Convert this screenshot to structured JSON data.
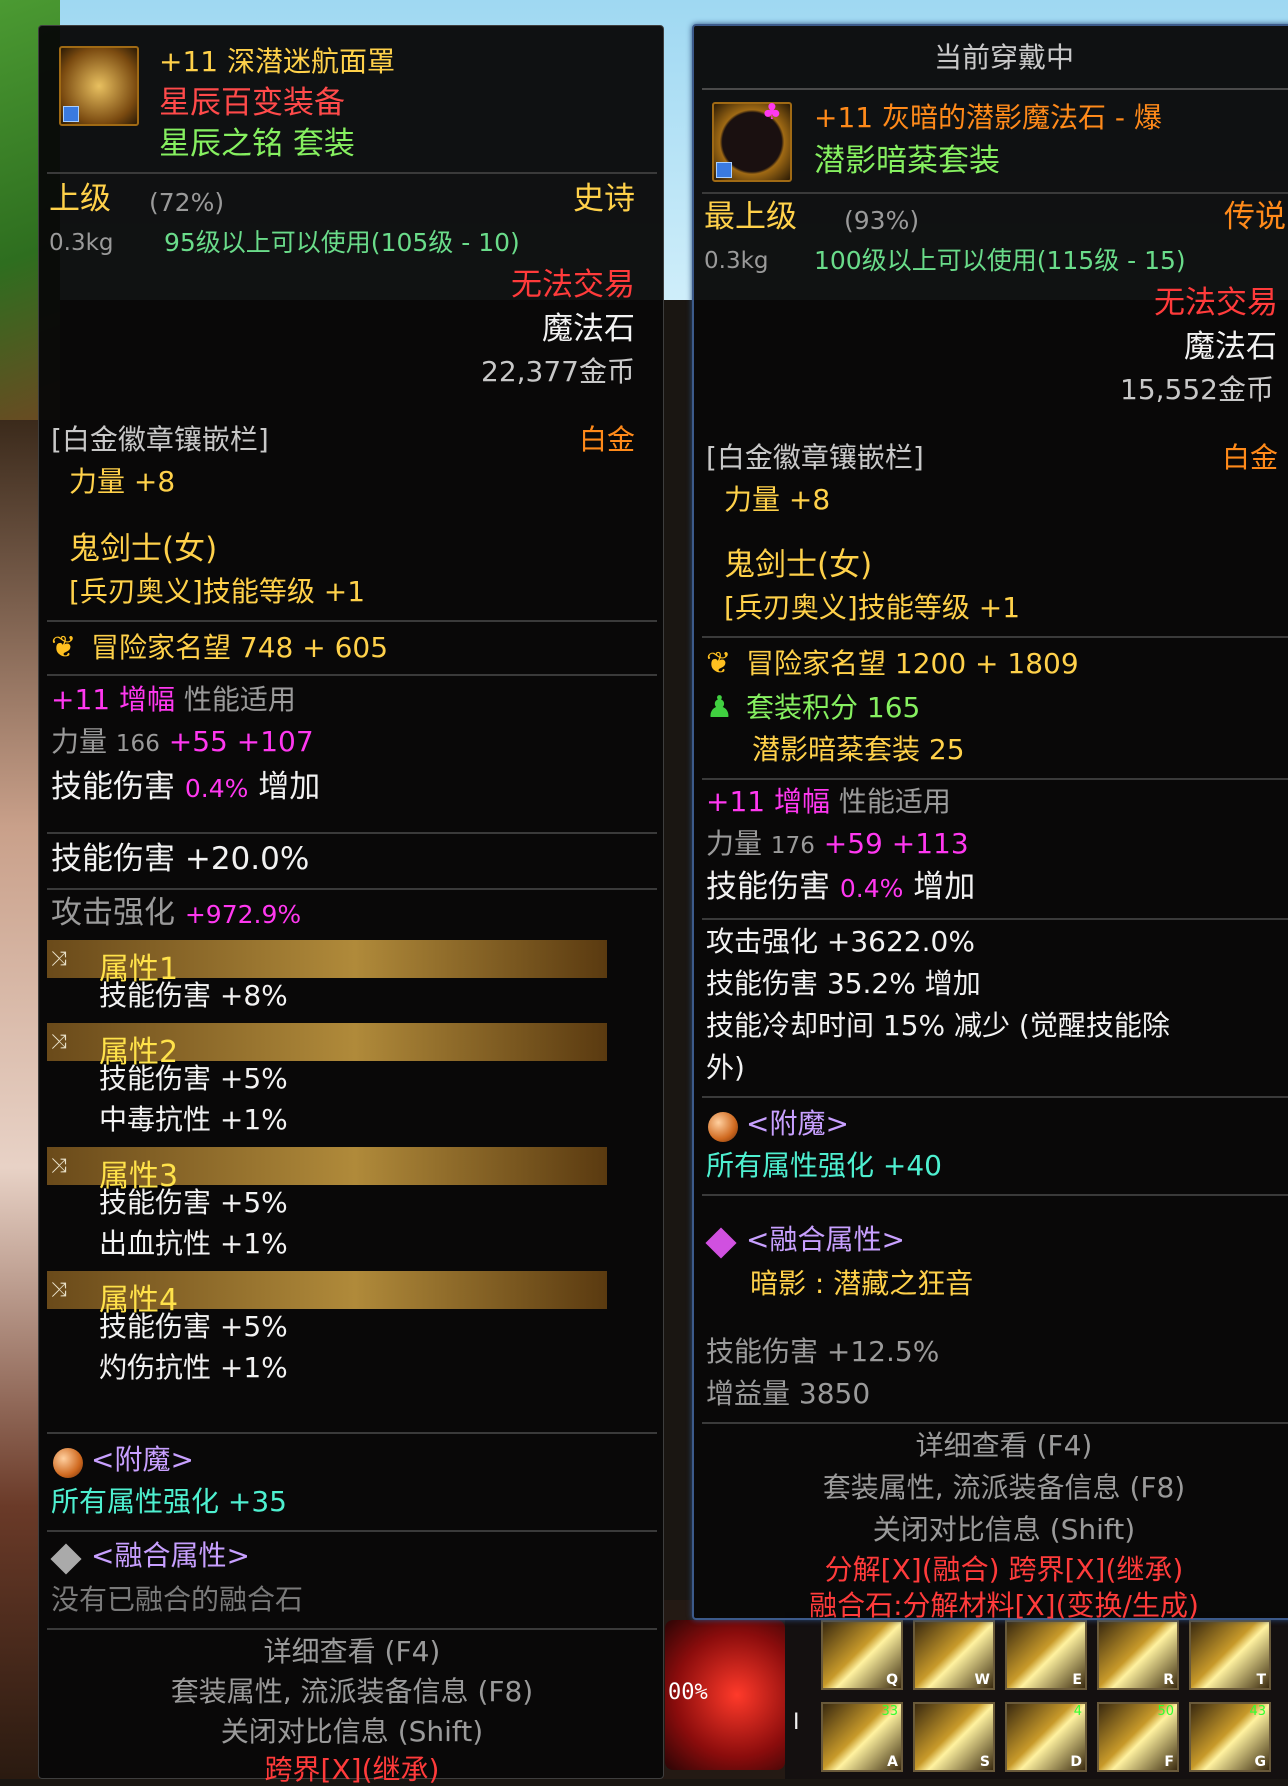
{
  "game": {
    "orb_percent": "00%",
    "skills": [
      {
        "key": "Q",
        "level": ""
      },
      {
        "key": "W",
        "level": ""
      },
      {
        "key": "E",
        "level": ""
      },
      {
        "key": "R",
        "level": ""
      },
      {
        "key": "T",
        "level": ""
      },
      {
        "key": "A",
        "level": "33"
      },
      {
        "key": "S",
        "level": ""
      },
      {
        "key": "D",
        "level": "4"
      },
      {
        "key": "F",
        "level": "50"
      },
      {
        "key": "G",
        "level": "43"
      }
    ],
    "side_key": "I"
  },
  "left": {
    "enhance": "+11",
    "name": "深潜迷航面罩",
    "category": "星辰百变装备",
    "set": "星辰之铭 套装",
    "grade": "上级",
    "grade_pct": "(72%)",
    "rarity": "史诗",
    "weight": "0.3kg",
    "level_req": "95级以上可以使用(105级 - 10)",
    "trade": "无法交易",
    "type": "魔法石",
    "price": "22,377金币",
    "socket": "[白金徽章镶嵌栏]",
    "socket_type": "白金",
    "str_bonus": "力量 +8",
    "class": "鬼剑士(女)",
    "skill_lv": "[兵刃奥义]技能等级 +1",
    "fame": "冒险家名望 748 + 605",
    "amp_head_enh": "+11",
    "amp_head_word": "增幅",
    "amp_head_tail": "性能适用",
    "str_label": "力量",
    "str_base": "166",
    "str_add1": "+55",
    "str_add2": "+107",
    "skdmg_label": "技能伤害",
    "skdmg_val": "0.4%",
    "skdmg_tail": "增加",
    "skdmg2": "技能伤害 +20.0%",
    "atk_label": "攻击强化",
    "atk_val": "+972.9%",
    "attrs": [
      {
        "label": "属性1",
        "lines": [
          "技能伤害 +8%"
        ]
      },
      {
        "label": "属性2",
        "lines": [
          "技能伤害 +5%",
          "中毒抗性 +1%"
        ]
      },
      {
        "label": "属性3",
        "lines": [
          "技能伤害 +5%",
          "出血抗性 +1%"
        ]
      },
      {
        "label": "属性4",
        "lines": [
          "技能伤害 +5%",
          "灼伤抗性 +1%"
        ]
      }
    ],
    "enchant_title": "<附魔>",
    "enchant_val": "所有属性强化 +35",
    "fusion_title": "<融合属性>",
    "fusion_val": "没有已融合的融合石",
    "footer1": "详细查看 (F4)",
    "footer2": "套装属性, 流派装备信息 (F8)",
    "footer3": "关闭对比信息 (Shift)",
    "footer4": "跨界[X](继承)"
  },
  "right": {
    "header": "当前穿戴中",
    "enhance": "+11",
    "name": "灰暗的潜影魔法石 - 爆",
    "set": "潜影暗棻套装",
    "grade": "最上级",
    "grade_pct": "(93%)",
    "rarity": "传说",
    "weight": "0.3kg",
    "level_req": "100级以上可以使用(115级 - 15)",
    "trade": "无法交易",
    "type": "魔法石",
    "price": "15,552金币",
    "socket": "[白金徽章镶嵌栏]",
    "socket_type": "白金",
    "str_bonus": "力量 +8",
    "class": "鬼剑士(女)",
    "skill_lv": "[兵刃奥义]技能等级 +1",
    "fame": "冒险家名望 1200 + 1809",
    "set_points": "套装积分 165",
    "set_points_sub": "潜影暗棻套装 25",
    "amp_head_enh": "+11",
    "amp_head_word": "增幅",
    "amp_head_tail": "性能适用",
    "str_label": "力量",
    "str_base": "176",
    "str_add1": "+59",
    "str_add2": "+113",
    "skdmg_label": "技能伤害",
    "skdmg_val": "0.4%",
    "skdmg_tail": "增加",
    "atk": "攻击强化 +3622.0%",
    "skdmg2": "技能伤害 35.2% 增加",
    "cooldown1": "技能冷却时间 15% 减少 (觉醒技能除",
    "cooldown2": "外)",
    "enchant_title": "<附魔>",
    "enchant_val": "所有属性强化 +40",
    "fusion_title": "<融合属性>",
    "fusion_name": "暗影 : 潜藏之狂音",
    "fusion_dmg": "技能伤害 +12.5%",
    "fusion_gain": "增益量 3850",
    "footer1": "详细查看 (F4)",
    "footer2": "套装属性, 流派装备信息 (F8)",
    "footer3": "关闭对比信息 (Shift)",
    "footer4": "分解[X](融合)    跨界[X](继承)",
    "footer5": "融合石:分解材料[X](变换/生成)"
  }
}
